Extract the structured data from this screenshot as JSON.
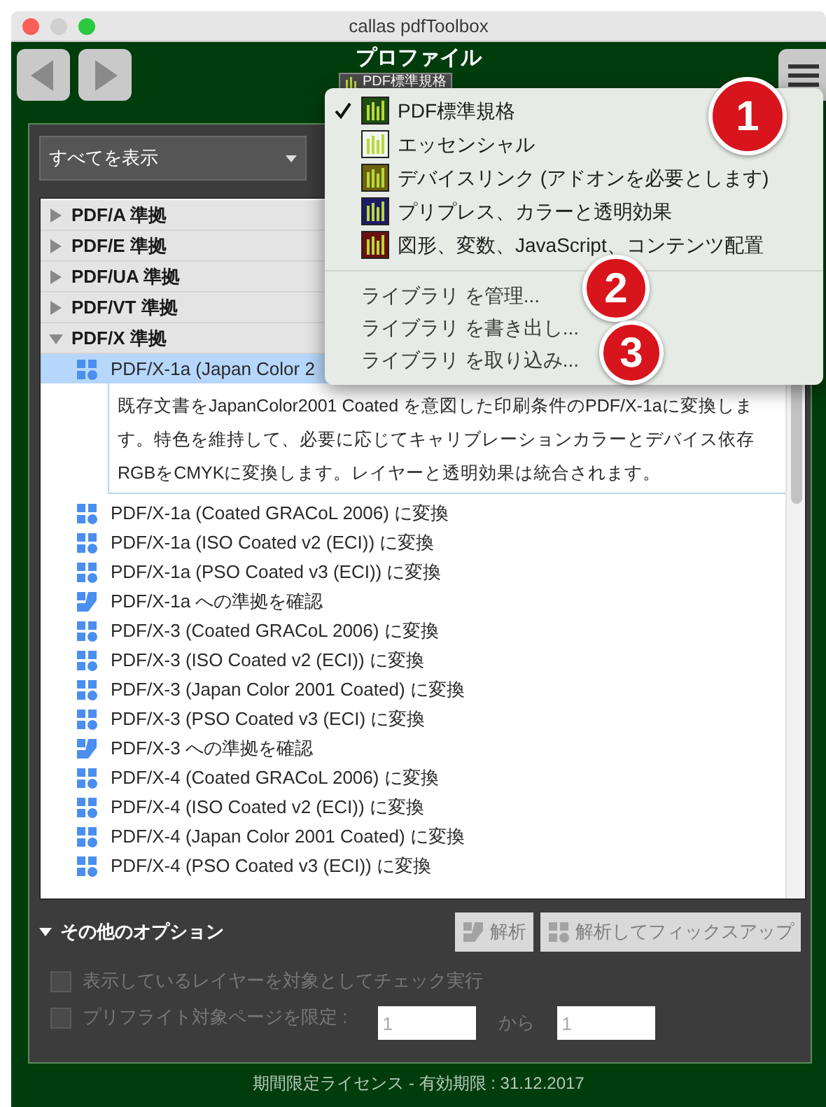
{
  "window": {
    "title": "callas pdfToolbox"
  },
  "header": {
    "title": "プロファイル",
    "library": "PDF標準規格"
  },
  "filter": {
    "value": "すべてを表示"
  },
  "tree": [
    {
      "label": "PDF/A 準拠",
      "expanded": false
    },
    {
      "label": "PDF/E 準拠",
      "expanded": false
    },
    {
      "label": "PDF/UA 準拠",
      "expanded": false
    },
    {
      "label": "PDF/VT 準拠",
      "expanded": false
    },
    {
      "label": "PDF/X 準拠",
      "expanded": true,
      "children": [
        {
          "label": "PDF/X-1a (Japan Color 2",
          "kind": "fixup",
          "selected": true,
          "description": "既存文書をJapanColor2001 Coated を意図した印刷条件のPDF/X-1aに変換します。特色を維持して、必要に応じてキャリブレーションカラーとデバイス依存RGBをCMYKに変換します。レイヤーと透明効果は統合されます。"
        },
        {
          "label": "PDF/X-1a (Coated GRACoL 2006) に変換",
          "kind": "fixup",
          "selected": false
        },
        {
          "label": "PDF/X-1a (ISO Coated v2 (ECI)) に変換",
          "kind": "fixup",
          "selected": false
        },
        {
          "label": "PDF/X-1a (PSO Coated v3 (ECI)) に変換",
          "kind": "fixup",
          "selected": false
        },
        {
          "label": "PDF/X-1a への準拠を確認",
          "kind": "check",
          "selected": false
        },
        {
          "label": "PDF/X-3 (Coated GRACoL 2006) に変換",
          "kind": "fixup",
          "selected": false
        },
        {
          "label": "PDF/X-3 (ISO Coated v2 (ECI)) に変換",
          "kind": "fixup",
          "selected": false
        },
        {
          "label": "PDF/X-3 (Japan Color 2001 Coated) に変換",
          "kind": "fixup",
          "selected": false
        },
        {
          "label": "PDF/X-3 (PSO Coated v3 (ECI) に変換",
          "kind": "fixup",
          "selected": false
        },
        {
          "label": "PDF/X-3 への準拠を確認",
          "kind": "check",
          "selected": false
        },
        {
          "label": "PDF/X-4 (Coated GRACoL 2006) に変換",
          "kind": "fixup",
          "selected": false
        },
        {
          "label": "PDF/X-4 (ISO Coated v2 (ECI)) に変換",
          "kind": "fixup",
          "selected": false
        },
        {
          "label": "PDF/X-4 (Japan Color 2001 Coated) に変換",
          "kind": "fixup",
          "selected": false
        },
        {
          "label": "PDF/X-4 (PSO Coated v3 (ECI)) に変換",
          "kind": "fixup",
          "selected": false
        }
      ]
    }
  ],
  "options": {
    "title": "その他のオプション",
    "expanded": true,
    "buttons": [
      {
        "label": "解析",
        "kind": "check",
        "disabled": true
      },
      {
        "label": "解析してフィックスアップ",
        "kind": "fixup",
        "disabled": true
      }
    ],
    "checks": [
      {
        "label": "表示しているレイヤーを対象としてチェック実行",
        "checked": false,
        "disabled": true
      },
      {
        "label": "プリフライト対象ページを限定 :",
        "checked": false,
        "disabled": true
      }
    ],
    "page_from": "1",
    "range_word": "から",
    "page_to": "1"
  },
  "status_bar": "期間限定ライセンス - 有効期限 : 31.12.2017",
  "library_menu": {
    "libraries": [
      {
        "label": "PDF標準規格",
        "selected": true,
        "color": "#1d4d12"
      },
      {
        "label": "エッセンシャル",
        "selected": false,
        "color": "#f2f5ee"
      },
      {
        "label": "デバイスリンク (アドオンを必要とします)",
        "selected": false,
        "color": "#6b6210"
      },
      {
        "label": "プリプレス、カラーと透明効果",
        "selected": false,
        "color": "#1c1c66"
      },
      {
        "label": "図形、変数、JavaScript、コンテンツ配置",
        "selected": false,
        "color": "#6b1010"
      }
    ],
    "actions": [
      "ライブラリ を管理...",
      "ライブラリ を書き出し...",
      "ライブラリ を取り込み..."
    ]
  },
  "callouts": [
    "1",
    "2",
    "3"
  ]
}
